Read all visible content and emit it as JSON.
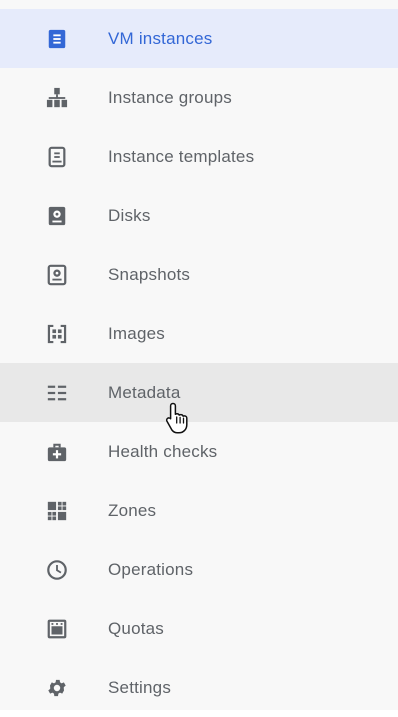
{
  "nav": {
    "items": [
      {
        "label": "VM instances",
        "icon": "vm-instance-icon",
        "state": "active"
      },
      {
        "label": "Instance groups",
        "icon": "instance-groups-icon"
      },
      {
        "label": "Instance templates",
        "icon": "instance-templates-icon"
      },
      {
        "label": "Disks",
        "icon": "disk-icon"
      },
      {
        "label": "Snapshots",
        "icon": "snapshot-icon"
      },
      {
        "label": "Images",
        "icon": "images-icon"
      },
      {
        "label": "Metadata",
        "icon": "metadata-icon",
        "state": "hover"
      },
      {
        "label": "Health checks",
        "icon": "health-checks-icon"
      },
      {
        "label": "Zones",
        "icon": "zones-icon"
      },
      {
        "label": "Operations",
        "icon": "operations-icon"
      },
      {
        "label": "Quotas",
        "icon": "quotas-icon"
      },
      {
        "label": "Settings",
        "icon": "settings-icon"
      }
    ]
  },
  "colors": {
    "active_background": "#e6ebfb",
    "active_text": "#3367d6",
    "hover_background": "#e8e8e8",
    "text": "#5f6368",
    "icon": "#5f6368"
  }
}
